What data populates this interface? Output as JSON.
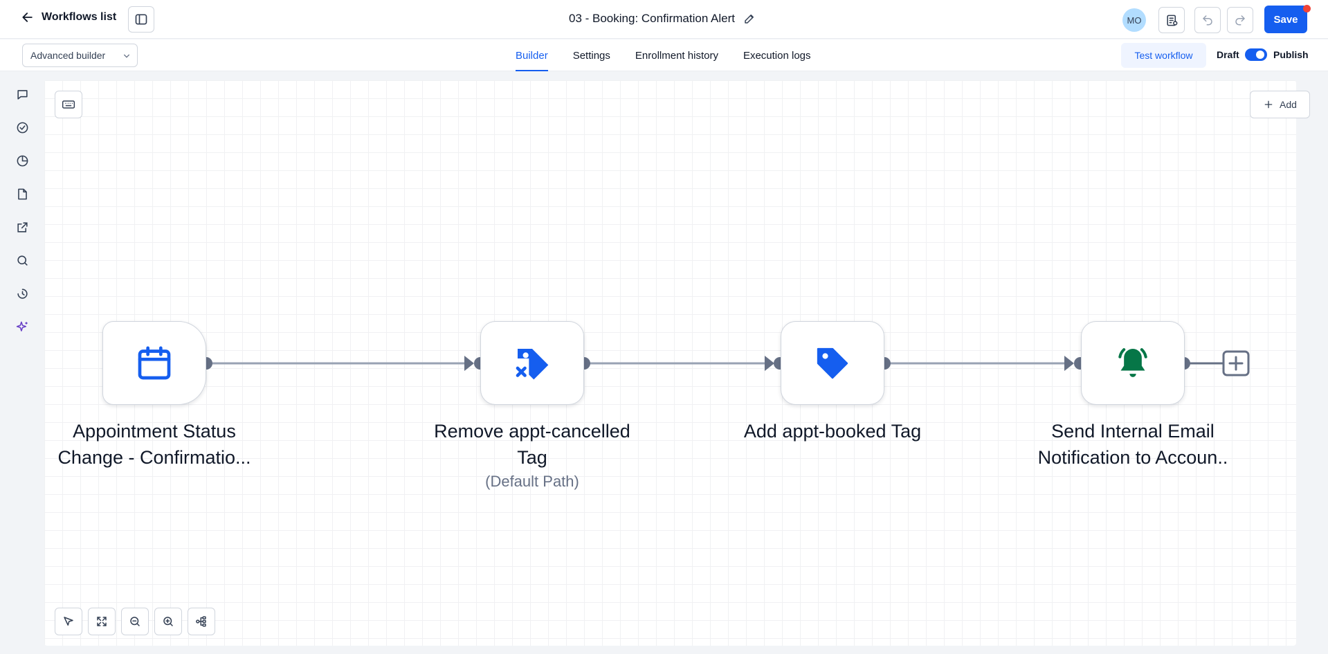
{
  "header": {
    "back_label": "Workflows list",
    "title": "03 - Booking: Confirmation Alert",
    "avatar_initials": "MO",
    "save_label": "Save"
  },
  "subbar": {
    "builder_mode": "Advanced builder",
    "tabs": [
      {
        "label": "Builder",
        "active": true
      },
      {
        "label": "Settings",
        "active": false
      },
      {
        "label": "Enrollment history",
        "active": false
      },
      {
        "label": "Execution logs",
        "active": false
      }
    ],
    "test_label": "Test workflow",
    "draft_label": "Draft",
    "publish_label": "Publish"
  },
  "rail": {
    "items": [
      "chat-icon",
      "check-circle-icon",
      "pie-chart-icon",
      "file-icon",
      "external-link-icon",
      "search-icon",
      "history-icon",
      "sparkle-icon"
    ]
  },
  "canvas": {
    "add_label": "Add",
    "nodes": [
      {
        "icon": "calendar-icon",
        "color": "#155eef",
        "label_line1": "Appointment Status",
        "label_line2": "Change - Confirmatio...",
        "sub": ""
      },
      {
        "icon": "tag-remove-icon",
        "color": "#155eef",
        "label_line1": "Remove appt-cancelled",
        "label_line2": "Tag",
        "sub": "(Default Path)"
      },
      {
        "icon": "tag-icon",
        "color": "#155eef",
        "label_line1": "Add appt-booked Tag",
        "label_line2": "",
        "sub": ""
      },
      {
        "icon": "bell-ringing-icon",
        "color": "#067647",
        "label_line1": "Send Internal Email",
        "label_line2": "Notification to Accoun..",
        "sub": ""
      }
    ]
  },
  "colors": {
    "accent": "#155eef",
    "connector": "#667085",
    "bell": "#067647"
  }
}
